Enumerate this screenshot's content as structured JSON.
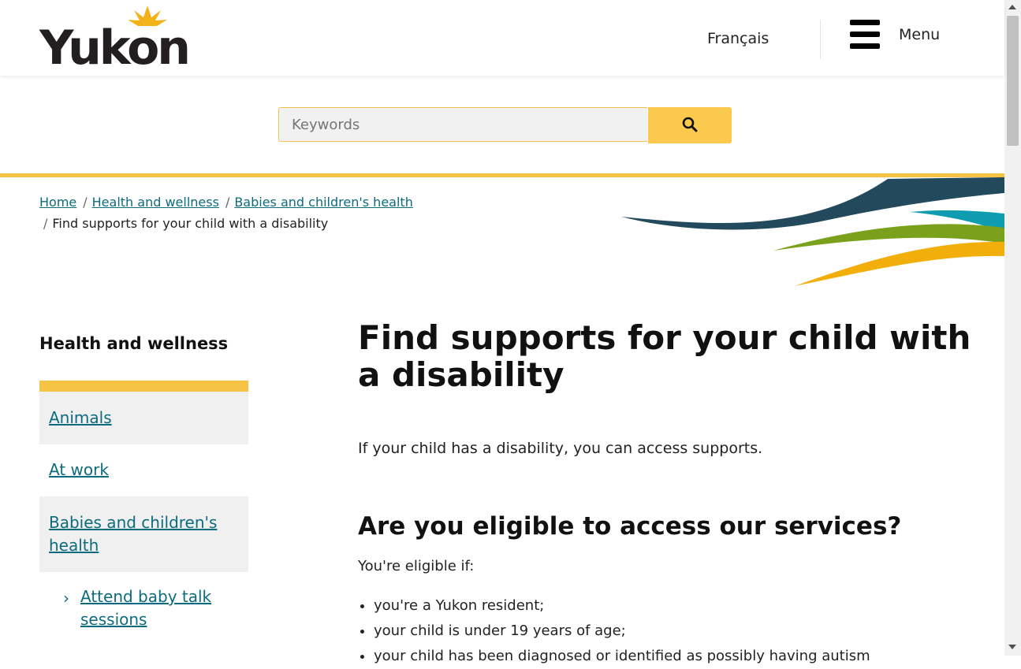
{
  "header": {
    "logo_text": "Yukon",
    "language_link": "Français",
    "menu_label": "Menu"
  },
  "search": {
    "placeholder": "Keywords",
    "button_icon": "search-icon"
  },
  "breadcrumb": {
    "items": [
      "Home",
      "Health and wellness",
      "Babies and children's health"
    ],
    "current": "Find supports for your child with a disability"
  },
  "sidebar": {
    "title": "Health and wellness",
    "items": [
      {
        "label": "Animals"
      },
      {
        "label": "At work"
      },
      {
        "label": "Babies and children's health"
      }
    ],
    "subitem": {
      "label": "Attend baby talk sessions",
      "icon": "chevron-right-icon"
    }
  },
  "main": {
    "title": "Find supports for your child with a disability",
    "intro": "If your child has a disability, you can access supports.",
    "section_heading": "Are you eligible to access our services?",
    "eligible_intro": "You're eligible if:",
    "criteria": [
      "you're a Yukon resident;",
      "your child is under 19 years of age;",
      "your child has been diagnosed or identified as possibly having autism"
    ]
  },
  "colors": {
    "accent_yellow": "#f6c244",
    "link_teal": "#0c6b7e",
    "wave_navy": "#234a5c",
    "wave_teal": "#0f9cb0",
    "wave_green": "#7ba11c",
    "wave_gold": "#f2ae0a"
  }
}
